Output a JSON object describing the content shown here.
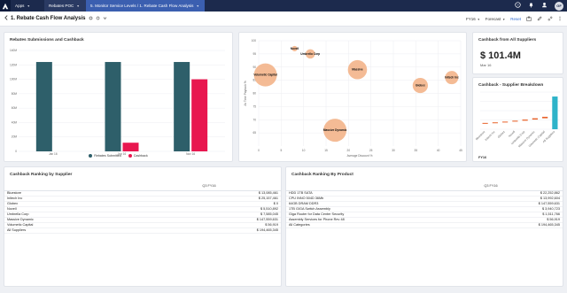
{
  "topbar": {
    "apps_label": "Apps",
    "workspace_label": "Rebates POC",
    "current_path": "5. Monitor Service Levels / 1. Rebate Cash Flow Analysis",
    "avatar_initials": "GF",
    "icons": [
      "logo-icon",
      "chevron-down-icon",
      "help-icon",
      "bell-icon",
      "user-icon"
    ]
  },
  "subheader": {
    "title": "1. Rebate Cash Flow Analysis",
    "period_filter": "FY16",
    "forecast_filter": "Forecast",
    "reset_label": "Reset"
  },
  "colors": {
    "teal": "#2e5f6a",
    "pink": "#e8174f",
    "bubble": "#f3b48a",
    "cyan": "#2eb3c9",
    "orange": "#e8622a"
  },
  "rebates_chart": {
    "title": "Rebates Submissions and Cashback",
    "chart_data": {
      "type": "bar",
      "categories": [
        "Jan 16",
        "Jun 16",
        "Nov 16"
      ],
      "ylim": [
        0,
        140000000
      ],
      "yticks": [
        "0",
        "20M",
        "40M",
        "60M",
        "80M",
        "100M",
        "120M",
        "140M"
      ],
      "series": [
        {
          "name": "Rebates Submitted",
          "values": [
            124000000,
            124000000,
            124000000
          ]
        },
        {
          "name": "Cashback",
          "values": [
            0,
            12000000,
            100000000
          ]
        }
      ]
    }
  },
  "bubble_chart": {
    "ylabel": "Av Time Payback %",
    "xlabel": "Average Discount %",
    "chart_data": {
      "type": "scatter",
      "xlim": [
        0,
        45
      ],
      "ylim": [
        60,
        100
      ],
      "xticks": [
        "0",
        "5",
        "10",
        "15",
        "20",
        "25",
        "30",
        "35",
        "40",
        "45"
      ],
      "yticks": [
        "65",
        "70",
        "75",
        "80",
        "85",
        "90",
        "95",
        "100"
      ],
      "points": [
        {
          "label": "Novell",
          "x": 8,
          "y": 97,
          "size": 1
        },
        {
          "label": "Umbrella Corp",
          "x": 11.5,
          "y": 95,
          "size": 3
        },
        {
          "label": "Volumetic Capital",
          "x": 1.5,
          "y": 87,
          "size": 10
        },
        {
          "label": "Massive",
          "x": 22,
          "y": 89,
          "size": 8
        },
        {
          "label": "Globex",
          "x": 36,
          "y": 83,
          "size": 6
        },
        {
          "label": "Initech Inc",
          "x": 43,
          "y": 86,
          "size": 5
        },
        {
          "label": "Massive Dynamic",
          "x": 17,
          "y": 66,
          "size": 10
        }
      ]
    }
  },
  "kpi_card": {
    "title": "Cashback from All Suppliers",
    "value": "$ 101.4M",
    "sub": "Mar 16"
  },
  "breakdown_card": {
    "title": "Cashback - Supplier Breakdown",
    "footer": "FY16",
    "chart_data": {
      "type": "bar",
      "categories": [
        "Bluestore",
        "Initech Inc",
        "Globex",
        "Novell",
        "Umbrella Corp",
        "Massive Dynamic",
        "Volumetic Capital",
        "All Suppliers"
      ],
      "values": [
        2,
        3,
        4,
        5,
        6,
        7,
        8,
        22
      ],
      "ylim": [
        0,
        25
      ],
      "yticks": [
        "",
        "",
        "",
        "",
        ""
      ]
    }
  },
  "supplier_table": {
    "title": "Cashback Ranking by Supplier",
    "column_header": "Q3 FY16",
    "rows": [
      {
        "name": "Bluestore",
        "value": "$ 13,085,461"
      },
      {
        "name": "Initech Inc",
        "value": "$ 25,157,461"
      },
      {
        "name": "Globex",
        "value": "$ 0"
      },
      {
        "name": "Novell",
        "value": "$ 5,510,892"
      },
      {
        "name": "Umbrella Corp",
        "value": "$ 7,585,045"
      },
      {
        "name": "Massive Dynamic",
        "value": "$ 147,559,631"
      },
      {
        "name": "Volumetic Capital",
        "value": "$ 56,919"
      }
    ],
    "total": {
      "name": "All Suppliers",
      "value": "$ 194,465,345"
    }
  },
  "product_table": {
    "title": "Cashback Ranking By Product",
    "column_header": "Q3 FY16",
    "rows": [
      {
        "name": "HDD 1TB SATA",
        "value": "$ 22,252,862"
      },
      {
        "name": "CPU INNO 504D 36Mb",
        "value": "$ 13,992,604"
      },
      {
        "name": "64GB DRAM DDR3",
        "value": "$ 147,559,631"
      },
      {
        "name": "1TB GIGA Switch Assembly",
        "value": "$ 3,940,723"
      },
      {
        "name": "Giga Router for Data Center Security",
        "value": "$ 1,511,766"
      },
      {
        "name": "Assembly Services for Phone Rev 48",
        "value": "$ 56,919"
      }
    ],
    "total": {
      "name": "All Categories",
      "value": "$ 194,465,345"
    }
  }
}
